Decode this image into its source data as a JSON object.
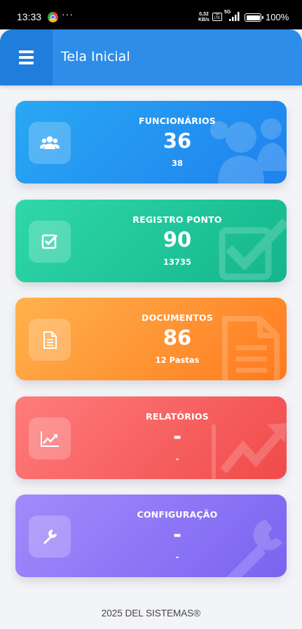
{
  "status_bar": {
    "time": "13:33",
    "dots": "···",
    "speed_top": "0,32",
    "speed_bottom": "KB/s",
    "volte": "Vo LTE",
    "network": "5G",
    "battery": "100%",
    "icons": [
      "chrome-icon",
      "signal-icon",
      "battery-icon"
    ]
  },
  "app_bar": {
    "title": "Tela Inicial",
    "color": "#2d8de8",
    "menu_icon": "menu-icon"
  },
  "cards": [
    {
      "key": "funcionarios",
      "label": "FUNCIONÁRIOS",
      "value": "36",
      "sub": "38",
      "icon": "users-icon",
      "colors": [
        "#29a8f3",
        "#1f81ee"
      ]
    },
    {
      "key": "registro-ponto",
      "label": "REGISTRO PONTO",
      "value": "90",
      "sub": "13735",
      "icon": "checkbox-icon",
      "colors": [
        "#2fd8a9",
        "#14b58c"
      ]
    },
    {
      "key": "documentos",
      "label": "DOCUMENTOS",
      "value": "86",
      "sub": "12 Pastas",
      "icon": "document-icon",
      "colors": [
        "#ffb24d",
        "#ff7a1f"
      ]
    },
    {
      "key": "relatorios",
      "label": "RELATÓRIOS",
      "value": "-",
      "sub": "-",
      "icon": "chart-line-icon",
      "colors": [
        "#ff7c7c",
        "#f04a4a"
      ]
    },
    {
      "key": "configuracao",
      "label": "CONFIGURAÇÃO",
      "value": "-",
      "sub": "-",
      "icon": "wrench-icon",
      "colors": [
        "#a28bfb",
        "#7a63f0"
      ]
    }
  ],
  "footer": {
    "text": "2025 DEL SISTEMAS®"
  }
}
